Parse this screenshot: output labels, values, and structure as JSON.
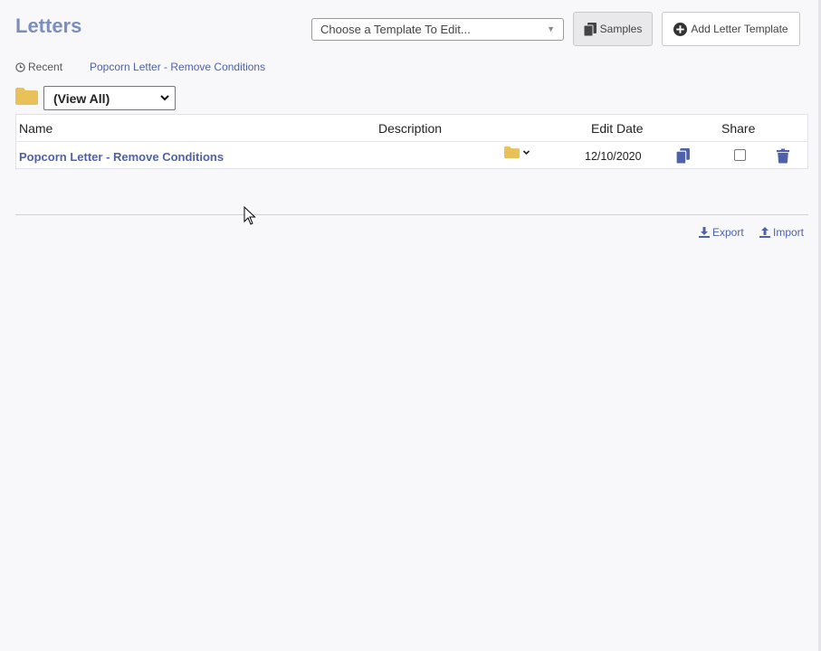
{
  "page": {
    "title": "Letters"
  },
  "toolbar": {
    "template_select_placeholder": "Choose a Template To Edit...",
    "samples_label": "Samples",
    "add_label": "Add Letter Template"
  },
  "recent": {
    "label": "Recent",
    "link": "Popcorn Letter - Remove Conditions"
  },
  "folder_filter": {
    "selected": "(View All)"
  },
  "table": {
    "headers": {
      "name": "Name",
      "description": "Description",
      "edit_date": "Edit Date",
      "share": "Share"
    },
    "rows": [
      {
        "name": "Popcorn Letter - Remove Conditions",
        "description": "",
        "edit_date": "12/10/2020",
        "shared": false
      }
    ]
  },
  "footer": {
    "export_label": "Export",
    "import_label": "Import"
  },
  "colors": {
    "accent": "#4f62a8",
    "title": "#7b8fbf",
    "folder": "#e8c158"
  }
}
